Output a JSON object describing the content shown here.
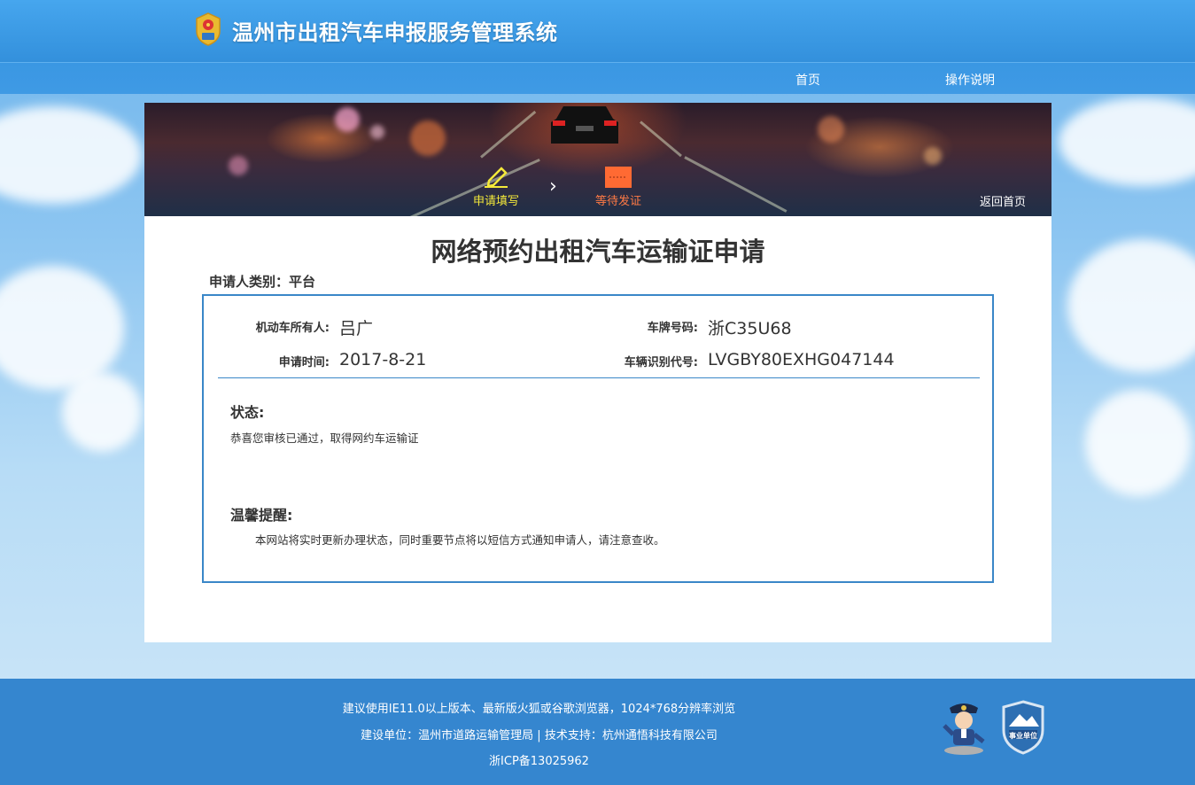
{
  "header": {
    "site_title": "温州市出租汽车申报服务管理系统",
    "nav": [
      "首页",
      "操作说明"
    ]
  },
  "banner": {
    "steps": [
      {
        "label": "申请填写",
        "color": "#f4e93a"
      },
      {
        "label": "等待发证",
        "color": "#ff7a45"
      }
    ],
    "back_home": "返回首页"
  },
  "main": {
    "title": "网络预约出租汽车运输证申请",
    "applicant_type": "申请人类别：平台",
    "fields": [
      {
        "label": "机动车所有人:",
        "value": "吕广"
      },
      {
        "label": "车牌号码:",
        "value": "浙C35U68"
      },
      {
        "label": "申请时间:",
        "value": "2017-8-21"
      },
      {
        "label": "车辆识别代号:",
        "value": "LVGBY80EXHG047144"
      }
    ],
    "status_title": "状态:",
    "status_text": "恭喜您审核已通过，取得网约车运输证",
    "tip_title": "温馨提醒:",
    "tip_text": "本网站将实时更新办理状态，同时重要节点将以短信方式通知申请人，请注意查收。"
  },
  "footer": {
    "line1": "建议使用IE11.0以上版本、最新版火狐或谷歌浏览器，1024*768分辨率浏览",
    "line2": "建设单位：温州市道路运输管理局 | 技术支持：杭州通悟科技有限公司",
    "line3": "浙ICP备13025962",
    "badge_text": "事业单位"
  },
  "colors": {
    "header_blue": "#3390dc",
    "border_blue": "#3a87c8",
    "footer_blue": "#3586cf"
  }
}
